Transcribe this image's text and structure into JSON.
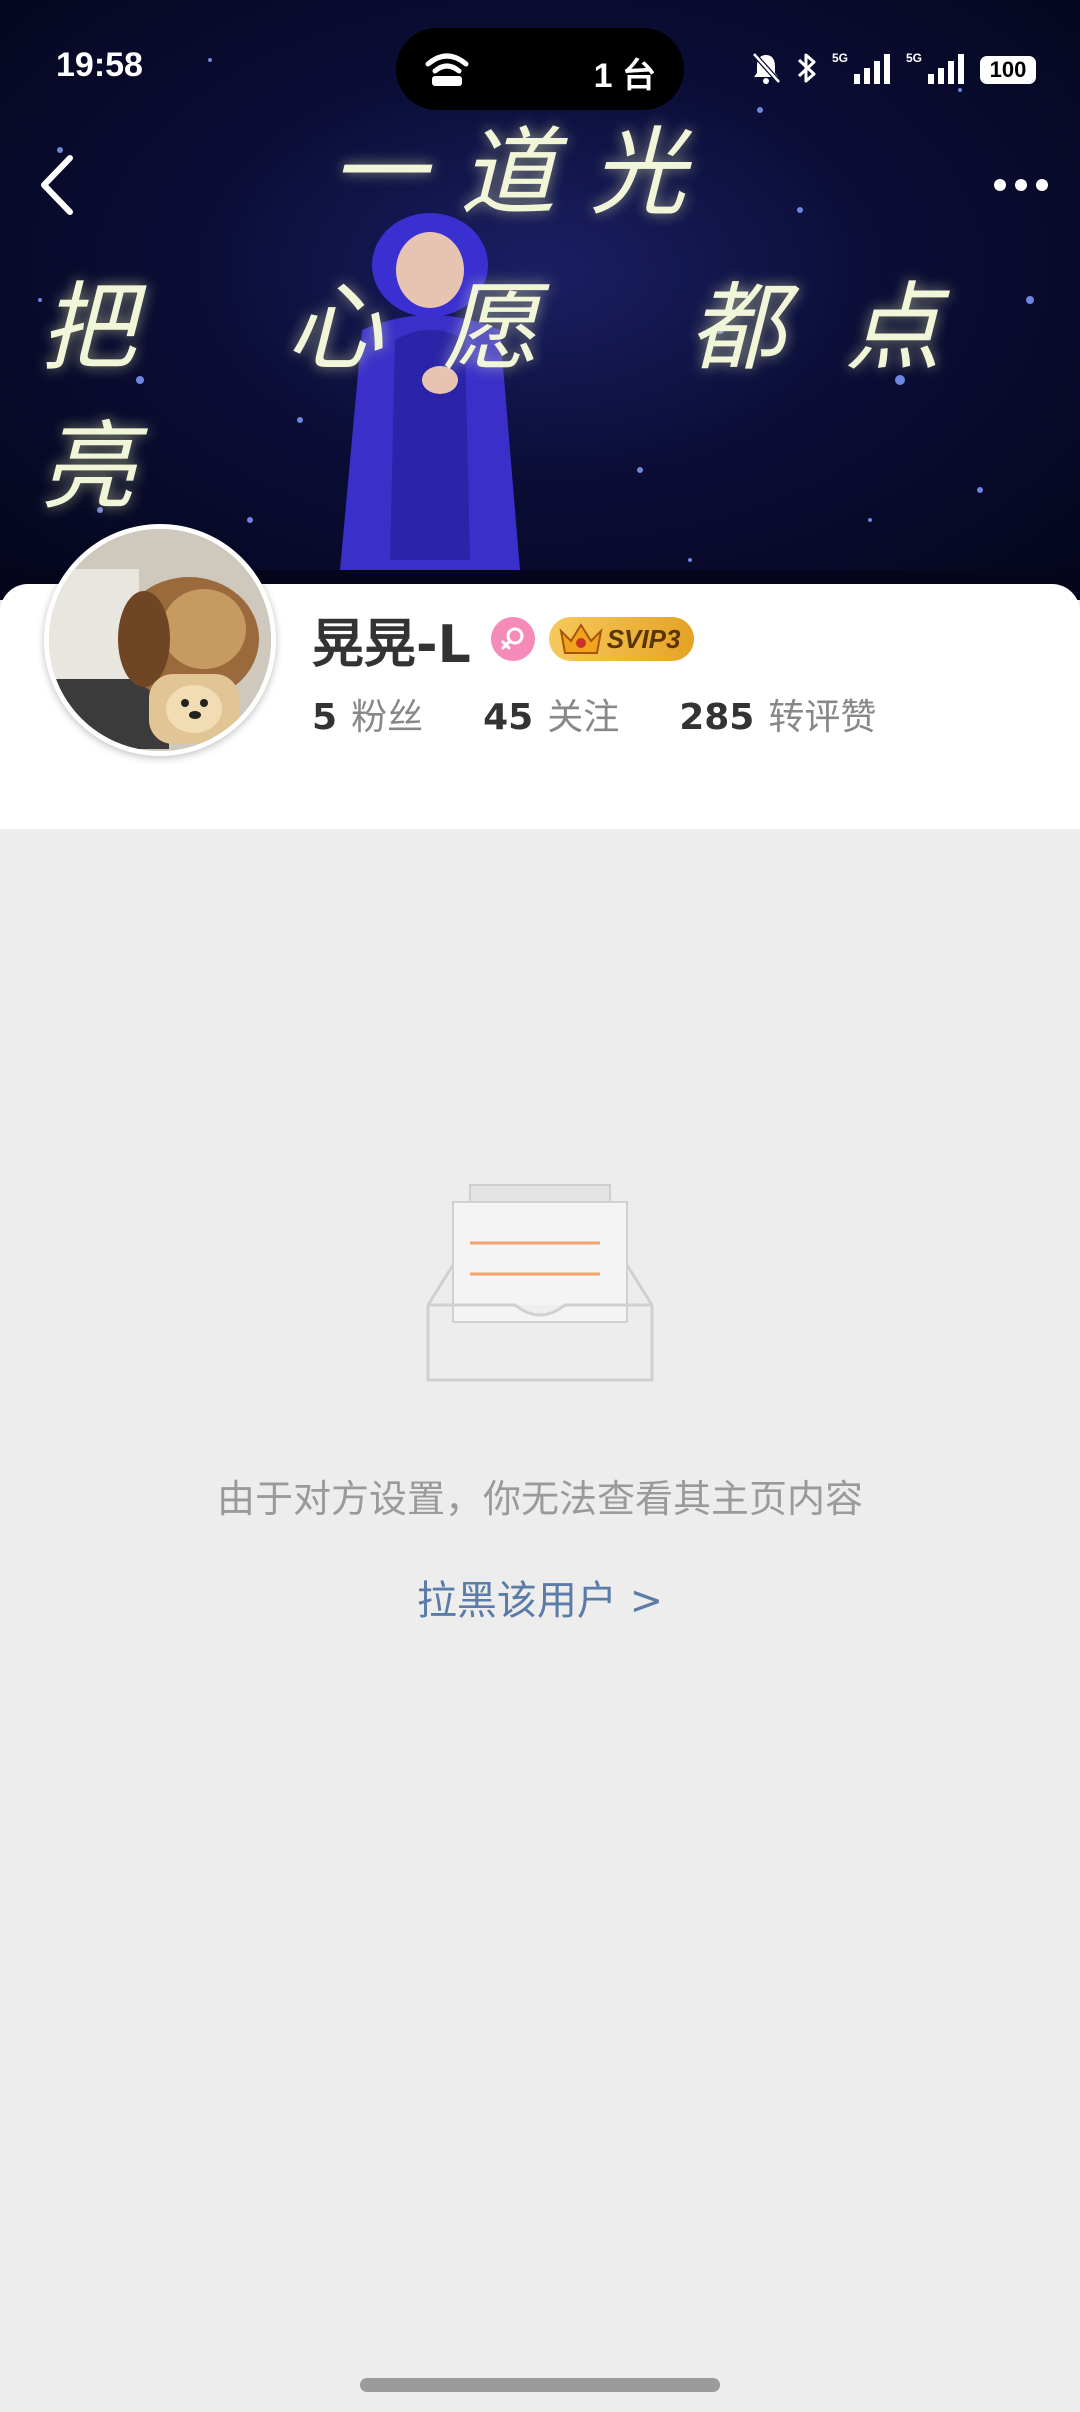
{
  "status_bar": {
    "time": "19:58",
    "pill_text": "1 台",
    "battery": "100",
    "network_labels": [
      "5G",
      "5G"
    ]
  },
  "cover": {
    "lyric_line_1": "一道光",
    "lyric_line_2": "把 心愿 都点亮"
  },
  "profile": {
    "username": "晃晃-L",
    "vip_badge": "SVIP3",
    "stats": [
      {
        "num": "5",
        "label": "粉丝"
      },
      {
        "num": "45",
        "label": "关注"
      },
      {
        "num": "285",
        "label": "转评赞"
      }
    ]
  },
  "empty_state": {
    "message": "由于对方设置，你无法查看其主页内容",
    "action_link": "拉黑该用户 >"
  },
  "colors": {
    "accent_link": "#5b7ca8",
    "gender_pink": "#f48bb8",
    "vip_gold": "#f7c95b",
    "background": "#ededed"
  },
  "icons": [
    "back-arrow-icon",
    "more-dots-icon",
    "cast-icon",
    "mute-bell-icon",
    "bluetooth-icon",
    "signal-icon",
    "female-icon",
    "crown-icon",
    "empty-inbox-icon"
  ]
}
